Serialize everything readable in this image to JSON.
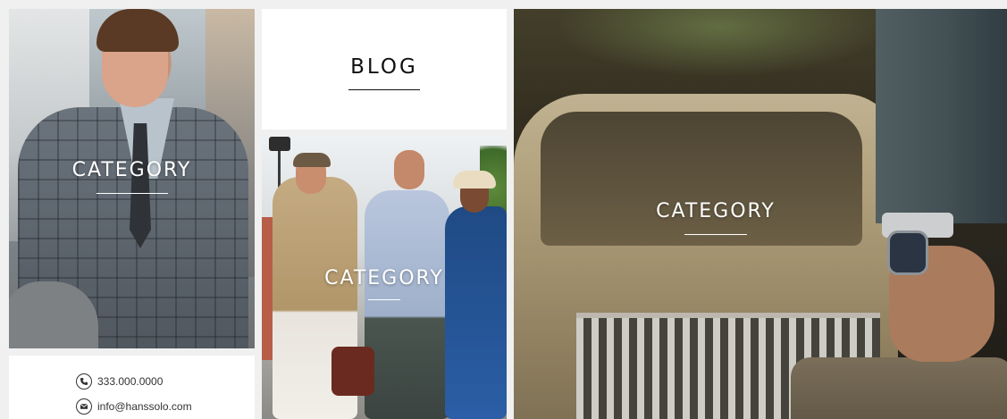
{
  "blog": {
    "title": "BLOG"
  },
  "categories": [
    {
      "label": "CATEGORY"
    },
    {
      "label": "CATEGORY"
    },
    {
      "label": "CATEGORY"
    }
  ],
  "contact": {
    "phone": "333.000.0000",
    "email": "info@hanssolo.com",
    "phone_icon": "phone-icon",
    "email_icon": "email-icon"
  }
}
